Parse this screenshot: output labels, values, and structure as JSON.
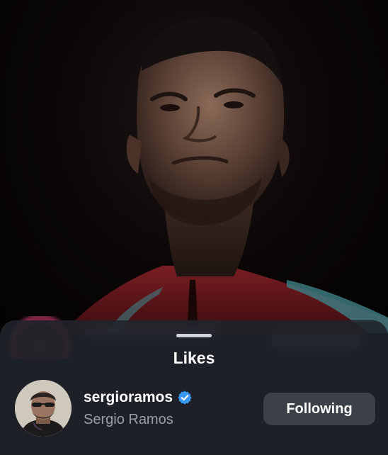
{
  "likes_sheet": {
    "title": "Likes",
    "users": [
      {
        "username": "sergioramos",
        "full_name": "Sergio Ramos",
        "verified": true,
        "follow_button_label": "Following"
      }
    ]
  },
  "colors": {
    "sheet_background": "#20242a",
    "button_background": "#3c4048",
    "verified_badge": "#3897f0",
    "secondary_text": "#9aa0a8"
  }
}
